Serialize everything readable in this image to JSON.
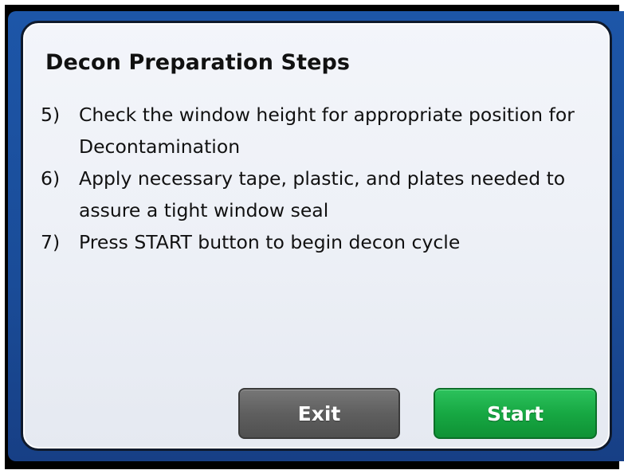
{
  "dialog": {
    "title": "Decon Preparation Steps",
    "steps": [
      {
        "number": "5)",
        "text": "Check the window height for appropriate position for Decontamination"
      },
      {
        "number": "6)",
        "text": "Apply necessary tape, plastic, and plates needed to assure a tight window seal"
      },
      {
        "number": "7)",
        "text": "Press START button to begin decon cycle"
      }
    ]
  },
  "buttons": {
    "exit_label": "Exit",
    "start_label": "Start"
  },
  "colors": {
    "background_blue": "#1a4c98",
    "exit_button": "#5f5f5f",
    "start_button": "#17a843"
  }
}
